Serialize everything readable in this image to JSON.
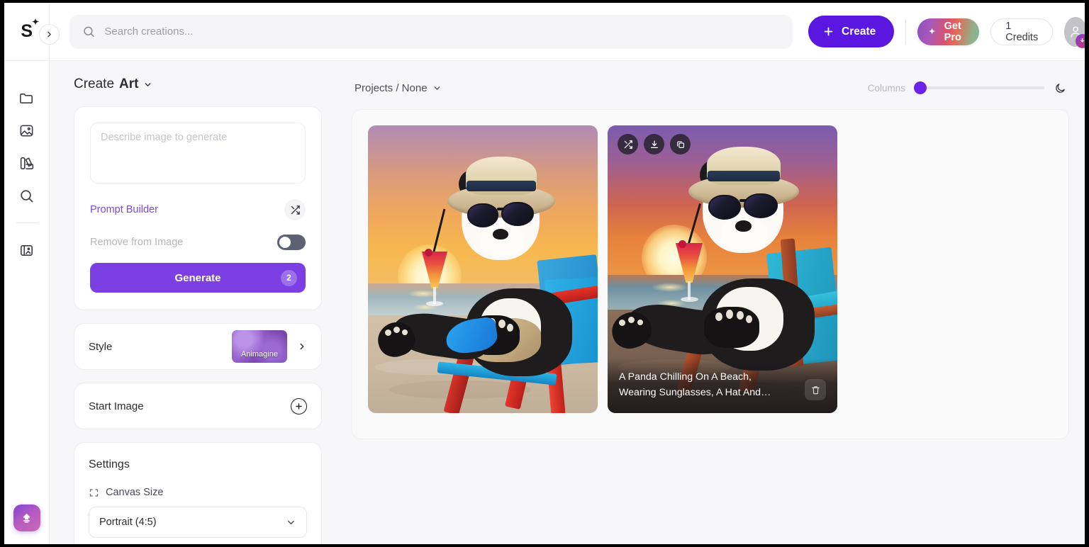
{
  "topbar": {
    "logo_text": "S",
    "logo_sparkle": "sparkle-icon",
    "collapse_icon": "chevron-right-icon",
    "search_placeholder": "Search creations...",
    "search_value": "",
    "search_icon": "search-icon",
    "create_label": "Create",
    "create_icon": "plus-icon",
    "get_pro_label": "Get Pro",
    "get_pro_icon": "sparkle-icon",
    "credits_label": "1 Credits",
    "avatar_icon": "user-icon",
    "avatar_badge_icon": "upgrade-arrow-icon"
  },
  "rail": {
    "items": [
      {
        "name": "folder-icon",
        "label": "Projects"
      },
      {
        "name": "image-icon",
        "label": "Images"
      },
      {
        "name": "palette-icon",
        "label": "Styles"
      },
      {
        "name": "search-icon",
        "label": "Explore"
      },
      {
        "name": "canvas-edit-icon",
        "label": "Canvas"
      }
    ],
    "fab_icon": "upgrade-arrow-icon"
  },
  "left_panel": {
    "title_prefix": "Create",
    "title_mode": "Art",
    "title_chevron": "chevron-down-icon",
    "prompt": {
      "placeholder": "Describe image to generate",
      "value": "",
      "builder_link": "Prompt Builder",
      "shuffle_icon": "shuffle-icon"
    },
    "remove_from_image": {
      "label": "Remove from Image",
      "enabled": false
    },
    "generate": {
      "label": "Generate",
      "count": "2"
    },
    "style": {
      "label": "Style",
      "value": "Animagine",
      "chevron": "chevron-right-icon"
    },
    "start_image": {
      "label": "Start Image",
      "add_icon": "plus-circle-icon"
    },
    "settings": {
      "title": "Settings",
      "canvas_size_label": "Canvas Size",
      "canvas_size_icon": "expand-icon",
      "canvas_size_value": "Portrait (4:5)",
      "canvas_size_chevron": "chevron-down-icon"
    }
  },
  "main": {
    "breadcrumb": "Projects / None",
    "breadcrumb_chevron": "chevron-down-icon",
    "columns_label": "Columns",
    "columns_value": 1,
    "theme_icon": "moon-icon",
    "gallery": [
      {
        "caption": "",
        "alt": "A panda chilling on a beach wearing sunglasses and a straw hat, holding a cocktail on a red and blue deck chair at sunset",
        "hovered": false
      },
      {
        "caption": "A Panda Chilling On A Beach, Wearing Sunglasses, A Hat And…",
        "alt": "A panda chilling on a beach wearing sunglasses and a straw hat, holding a cocktail on a teal deck chair at sunset",
        "hovered": true,
        "tools": [
          {
            "name": "shuffle-icon"
          },
          {
            "name": "download-icon"
          },
          {
            "name": "copy-icon"
          }
        ],
        "delete_icon": "trash-icon"
      }
    ]
  },
  "colors": {
    "accent": "#7b3fe4",
    "create_button": "#5a17e0",
    "slider_thumb": "#6b21e8",
    "prompt_link": "#7b46e3",
    "panel_bg": "#f7f7f9",
    "toggle_off": "#5c6274"
  }
}
